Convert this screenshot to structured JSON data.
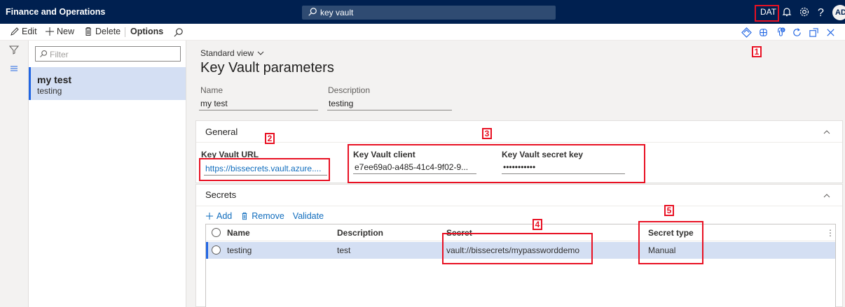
{
  "app": {
    "title": "Finance and Operations",
    "search_value": "key vault",
    "company": "DAT",
    "avatar_initials": "AD"
  },
  "actions": {
    "edit": "Edit",
    "new": "New",
    "delete": "Delete",
    "options": "Options"
  },
  "list": {
    "filter_placeholder": "Filter",
    "items": [
      {
        "title": "my test",
        "subtitle": "testing"
      }
    ]
  },
  "page": {
    "view": "Standard view",
    "title": "Key Vault parameters",
    "name_label": "Name",
    "name_value": "my test",
    "description_label": "Description",
    "description_value": "testing"
  },
  "general": {
    "header": "General",
    "url_label": "Key Vault URL",
    "url_value": "https://bissecrets.vault.azure....",
    "client_label": "Key Vault client",
    "client_value": "e7ee69a0-a485-41c4-9f02-9...",
    "secret_key_label": "Key Vault secret key",
    "secret_key_value": "•••••••••••"
  },
  "secrets": {
    "header": "Secrets",
    "add": "Add",
    "remove": "Remove",
    "validate": "Validate",
    "columns": {
      "name": "Name",
      "description": "Description",
      "secret": "Secret",
      "secret_type": "Secret type"
    },
    "rows": [
      {
        "name": "testing",
        "description": "test",
        "secret": "vault://bissecrets/mypassworddemo",
        "secret_type": "Manual"
      }
    ]
  },
  "annotations": [
    "1",
    "2",
    "3",
    "4",
    "5"
  ],
  "colors": {
    "nav": "#002050",
    "accent": "#2266e3",
    "selection": "#d4dff3",
    "annotation": "#e81123",
    "link": "#0f6cbd"
  }
}
